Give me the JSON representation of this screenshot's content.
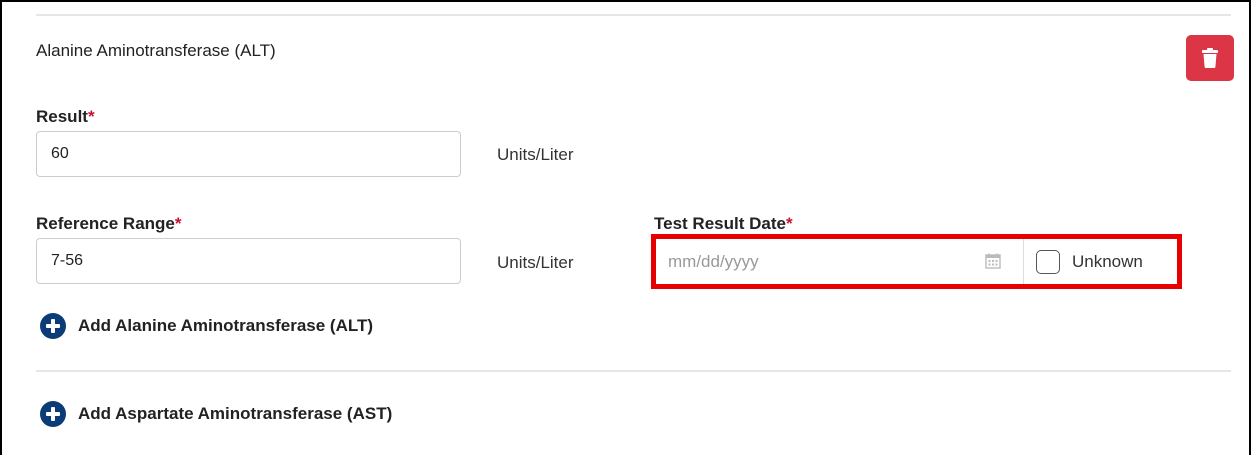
{
  "section": {
    "title": "Alanine Aminotransferase (ALT)",
    "delete_icon": "trash-icon"
  },
  "result": {
    "label": "Result",
    "required_mark": "*",
    "value": "60",
    "unit": "Units/Liter"
  },
  "reference_range": {
    "label": "Reference Range",
    "required_mark": "*",
    "value": "7-56",
    "unit": "Units/Liter"
  },
  "test_result_date": {
    "label": "Test Result Date",
    "required_mark": "*",
    "placeholder": "mm/dd/yyyy",
    "unknown_label": "Unknown",
    "unknown_checked": false,
    "highlight_color": "#e60000"
  },
  "actions": {
    "add_alt_label": "Add Alanine Aminotransferase (ALT)",
    "add_ast_label": "Add Aspartate Aminotransferase (AST)",
    "add_icon": "plus-circle-icon"
  },
  "colors": {
    "danger": "#dc3545",
    "required": "#c8102e",
    "icon_navy": "#0b3c78"
  }
}
